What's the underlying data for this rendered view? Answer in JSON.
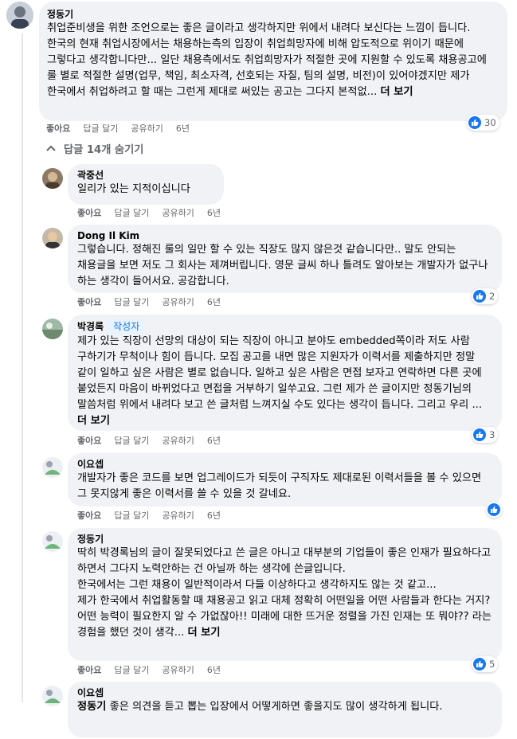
{
  "main_comment": {
    "author": "정동기",
    "text": "취업준비생을 위한 조언으로는 좋은 글이라고 생각하지만 위에서 내려다 보신다는 느낌이 듭니다. 한국의 현재 취업시장에서는 채용하는측의 입장이 취업희망자에 비해 압도적으로 위이기 때문에 그렇다고 생각합니다만... 일단 채용측에서도 취업희망자가 적절한 곳에 지원할 수 있도록 채용공고에 룰 별로 적절한 설명(업무, 책임, 최소자격, 선호되는 자질, 팀의 설명, 비전)이 있어야겠지만 제가 한국에서 취업하려고 할 때는 그런게 제대로 써있는 공고는 그다지 본적없...",
    "more": "더 보기",
    "like": "좋아요",
    "reply": "답글 달기",
    "share": "공유하기",
    "time": "6년",
    "reactions": "30"
  },
  "hide_replies": "답글 14개 숨기기",
  "replies": [
    {
      "author": "곽중선",
      "text": "일리가 있는 지적이십니다",
      "like": "좋아요",
      "reply": "답글 달기",
      "share": "공유하기",
      "time": "6년"
    },
    {
      "author": "Dong Il Kim",
      "text": "그렇습니다. 정해진 룰의 일만 할 수 있는 직장도 많지 않은것 같습니다만.. 말도 안되는 채용글을 보면 저도 그 회사는 제껴버립니다. 영문 글씨 하나 틀려도 알아보는 개발자가 없구나 하는 생각이 들어서요. 공감합니다.",
      "like": "좋아요",
      "reply": "답글 달기",
      "share": "공유하기",
      "time": "6년",
      "reactions": "2"
    },
    {
      "author": "박경록",
      "badge": "작성자",
      "text": "제가 있는 직장이 선망의 대상이 되는 직장이 아니고 분야도 embedded쪽이라 저도 사람 구하기가 무척이나 힘이 듭니다. 모집 공고를 내면 많은 지원자가 이력서를 제출하지만 정말 같이 일하고 싶은 사람은 별로 없습니다. 일하고 싶은 사람은 면접 보자고 연락하면 다른 곳에 붙었든지 마음이 바뀌었다고 면접을 거부하기 일쑤고요. 그런 제가 쓴 글이지만 정동기님의 말씀처럼 위에서 내려다 보고 쓴 글처럼 느껴지실 수도 있다는 생각이 듭니다. 그리고 우리 ...",
      "more": "더 보기",
      "like": "좋아요",
      "reply": "답글 달기",
      "share": "공유하기",
      "time": "6년",
      "reactions": "3"
    },
    {
      "author": "이요셉",
      "text": "개발자가 좋은 코드를 보면 업그레이드가 되듯이 구직자도 제대로된 이력서들을 볼 수 있으면 그 못지않게 좋은 이력서를 쓸 수 있을 것 갈네요.",
      "like": "좋아요",
      "reply": "답글 달기",
      "share": "공유하기",
      "time": "6년"
    },
    {
      "author": "정동기",
      "text1": "딱히 박경록님의 글이 잘못되었다고 쓴 글은 아니고 대부분의 기업들이 좋은 인재가 필요하다고 하면서 그다지 노력안하는 건 아닐까 하는 생각에 쓴글입니다.",
      "text2": "한국에서는 그런 채용이 일반적이라서 다들 이상하다고 생각하지도 않는 것 같고...",
      "text3": "제가 한국에서 취업활동할 때 채용공고 읽고 대체 정확히 어떤일을 어떤 사람들과 한다는 거지? 어떤 능력이 필요한지 알 수 가없잖아!! 미래에 대한 뜨거운 정렬을 가진 인재는 또 뭐야?? 라는 경험을 했던 것이 생각...",
      "more": "더 보기",
      "like": "좋아요",
      "reply": "답글 달기",
      "share": "공유하기",
      "time": "6년",
      "reactions": "5"
    },
    {
      "author": "이요셉",
      "mention": "정동기",
      "text": " 좋은 의견을 듣고 뽑는 입장에서 어떻게하면 좋을지도 많이 생각하게 됩니다."
    }
  ],
  "colors": {
    "bubble": "#f0f2f5",
    "accent": "#1877f2",
    "muted": "#65676b"
  },
  "icons": [
    "thumbs-up-icon",
    "chevron-up-icon",
    "avatar-placeholder-icon"
  ]
}
